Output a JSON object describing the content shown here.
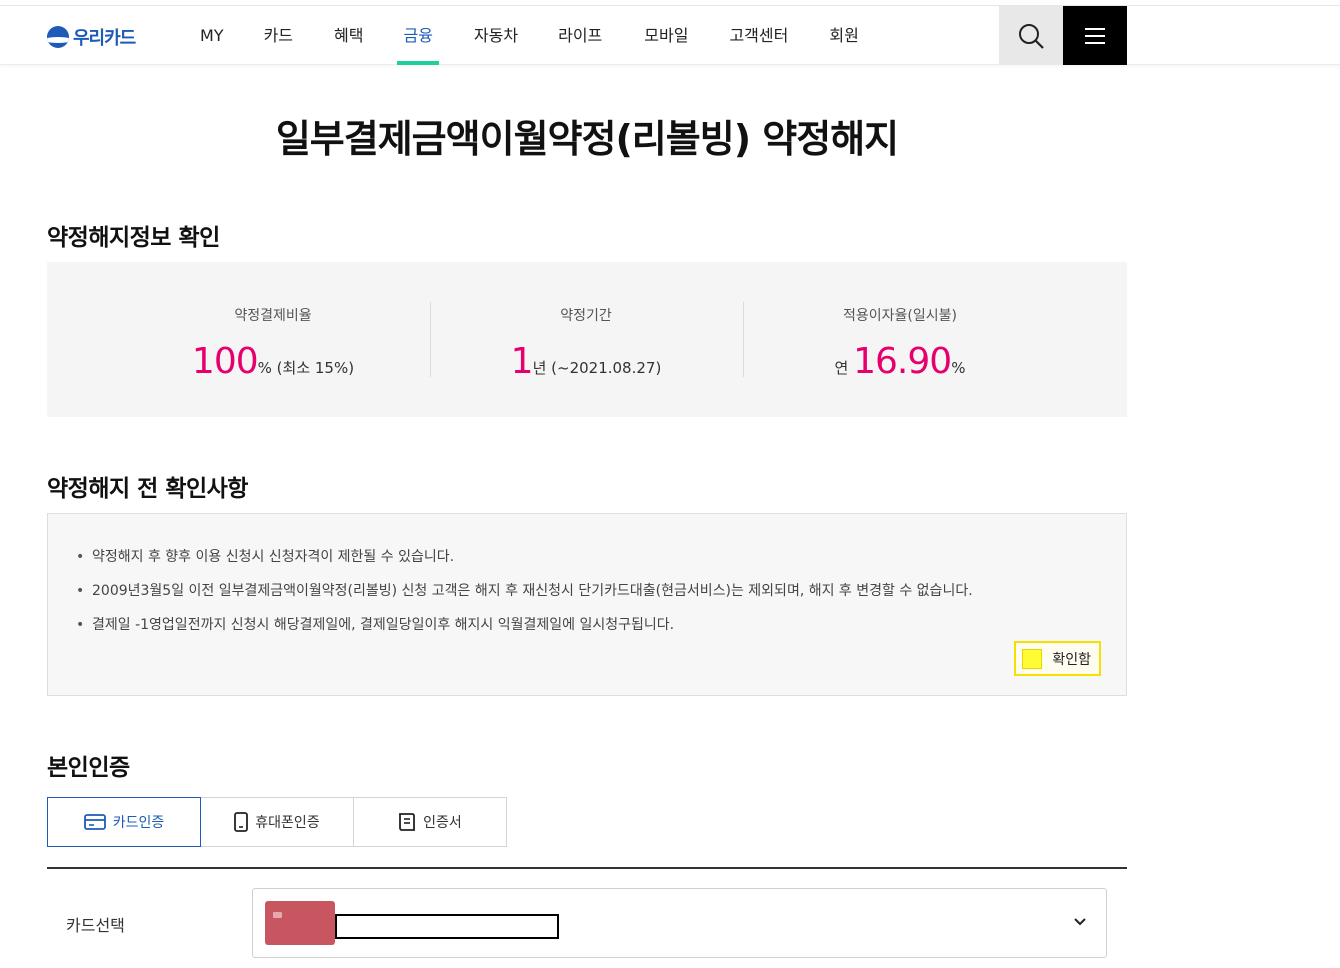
{
  "header": {
    "logo_text": "우리카드",
    "nav": [
      {
        "label": "MY"
      },
      {
        "label": "카드"
      },
      {
        "label": "혜택"
      },
      {
        "label": "금융",
        "active": true
      },
      {
        "label": "자동차"
      },
      {
        "label": "라이프"
      },
      {
        "label": "모바일"
      },
      {
        "label": "고객센터"
      },
      {
        "label": "회원"
      }
    ],
    "search_icon": "search-icon",
    "menu_icon": "hamburger-icon",
    "brand_color": "#1e5bb8",
    "active_indicator_color": "#1fcf9b"
  },
  "page_title": "일부결제금액이월약정(리볼빙) 약정해지",
  "info_section": {
    "title": "약정해지정보 확인",
    "items": [
      {
        "label": "약정결제비율",
        "prefix": "",
        "value": "100",
        "suffix": "% (최소 15%)"
      },
      {
        "label": "약정기간",
        "prefix": "",
        "value": "1",
        "suffix": "년 (~2021.08.27)"
      },
      {
        "label": "적용이자율(일시불)",
        "prefix": "연 ",
        "value": "16.90",
        "suffix": "%"
      }
    ],
    "highlight_color": "#e5006e"
  },
  "notice_section": {
    "title": "약정해지 전 확인사항",
    "items": [
      "약정해지 후 향후 이용 신청시 신청자격이 제한될 수 있습니다.",
      "2009년3월5일 이전 일부결제금액이월약정(리볼빙) 신청 고객은 해지 후 재신청시 단기카드대출(현금서비스)는 제외되며, 해지 후 변경할 수 없습니다.",
      "결제일 -1영업일전까지 신청시 해당결제일에, 결제일당일이후 해지시 익월결제일에 일시청구됩니다."
    ],
    "confirm_label": "확인함",
    "confirm_checked": false
  },
  "auth_section": {
    "title": "본인인증",
    "tabs": [
      {
        "label": "카드인증",
        "icon": "card-icon",
        "active": true
      },
      {
        "label": "휴대폰인증",
        "icon": "phone-icon",
        "active": false
      },
      {
        "label": "인증서",
        "icon": "certificate-icon",
        "active": false
      }
    ],
    "card_select_label": "카드선택",
    "card_select_value": "",
    "card_color": "#c85660"
  }
}
